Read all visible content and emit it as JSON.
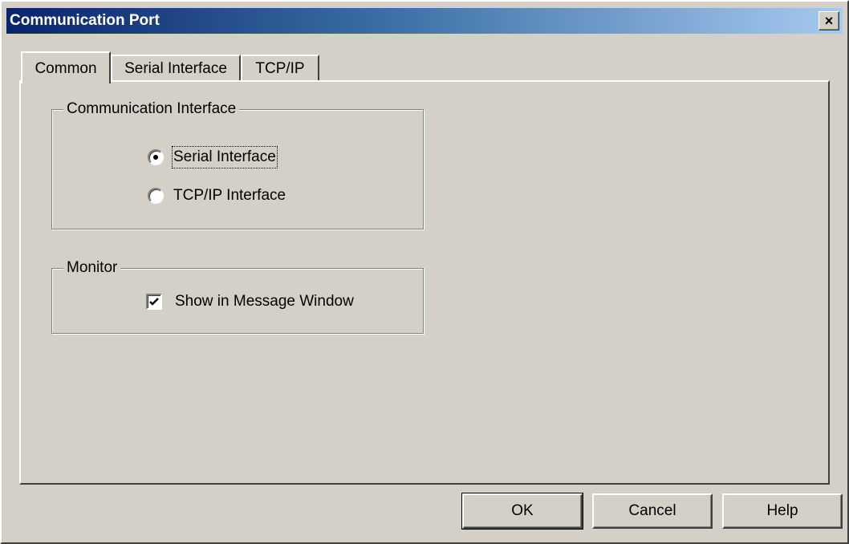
{
  "window": {
    "title": "Communication Port",
    "close_glyph": "×",
    "close_icon": "close-icon"
  },
  "tabs": [
    {
      "label": "Common",
      "active": true
    },
    {
      "label": "Serial Interface",
      "active": false
    },
    {
      "label": "TCP/IP",
      "active": false
    }
  ],
  "comm_group": {
    "legend": "Communication Interface",
    "options": [
      {
        "label": "Serial Interface",
        "selected": true
      },
      {
        "label": "TCP/IP Interface",
        "selected": false
      }
    ]
  },
  "monitor_group": {
    "legend": "Monitor",
    "checkbox_label": "Show in Message Window",
    "checked": true
  },
  "buttons": {
    "ok": "OK",
    "cancel": "Cancel",
    "help": "Help"
  },
  "colors": {
    "titlebar_start": "#0a246a",
    "titlebar_end": "#a6caf0",
    "face": "#d4d0c8"
  }
}
